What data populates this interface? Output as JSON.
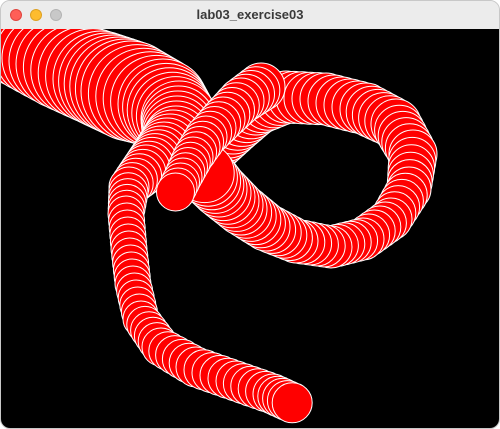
{
  "window": {
    "title": "lab03_exercise03"
  },
  "sketch": {
    "background_color": "#000000",
    "fill_color": "#ff0000",
    "stroke_color": "#ffffff"
  }
}
